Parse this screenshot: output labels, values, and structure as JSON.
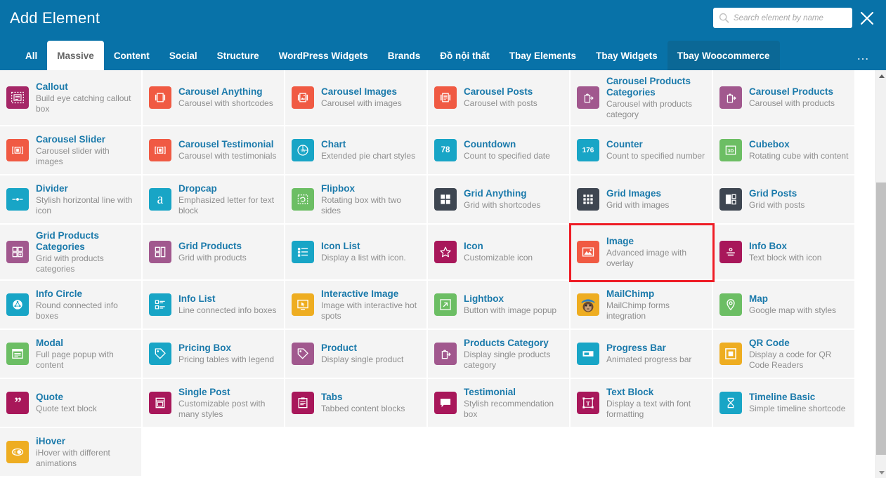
{
  "header": {
    "title": "Add Element",
    "search": {
      "placeholder": "Search element by name",
      "value": ""
    },
    "search_icon": "search-icon",
    "close_icon": "close-icon",
    "bg_color": "#0872a8"
  },
  "tabs": {
    "more_label": "…",
    "items": [
      {
        "label": "All",
        "state": "normal"
      },
      {
        "label": "Massive",
        "state": "active"
      },
      {
        "label": "Content",
        "state": "normal"
      },
      {
        "label": "Social",
        "state": "normal"
      },
      {
        "label": "Structure",
        "state": "normal"
      },
      {
        "label": "WordPress Widgets",
        "state": "normal"
      },
      {
        "label": "Brands",
        "state": "normal"
      },
      {
        "label": "Đồ nội thất",
        "state": "normal"
      },
      {
        "label": "Tbay Elements",
        "state": "normal"
      },
      {
        "label": "Tbay Widgets",
        "state": "normal"
      },
      {
        "label": "Tbay Woocommerce",
        "state": "semiactive"
      }
    ]
  },
  "colors": {
    "title_link": "#1b7aab",
    "desc": "#8e8e8e",
    "card_bg": "#f4f4f4",
    "selection_outline": "#ee1c25"
  },
  "elements": [
    {
      "title": "Callout",
      "desc": "Build eye catching callout box",
      "icon": "callout-icon",
      "color": "#a52767"
    },
    {
      "title": "Carousel Anything",
      "desc": "Carousel with shortcodes",
      "icon": "carousel-anything-icon",
      "color": "#f05a43"
    },
    {
      "title": "Carousel Images",
      "desc": "Carousel with images",
      "icon": "carousel-images-icon",
      "color": "#f05a43"
    },
    {
      "title": "Carousel Posts",
      "desc": "Carousel with posts",
      "icon": "carousel-posts-icon",
      "color": "#f05a43"
    },
    {
      "title": "Carousel Products Categories",
      "desc": "Carousel with products category",
      "icon": "carousel-products-categories-icon",
      "color": "#a1588e"
    },
    {
      "title": "Carousel Products",
      "desc": "Carousel with products",
      "icon": "carousel-products-icon",
      "color": "#a1588e"
    },
    {
      "title": "Carousel Slider",
      "desc": "Carousel slider with images",
      "icon": "carousel-slider-icon",
      "color": "#f05a43"
    },
    {
      "title": "Carousel Testimonial",
      "desc": "Carousel with testimonials",
      "icon": "carousel-testimonial-icon",
      "color": "#f05a43"
    },
    {
      "title": "Chart",
      "desc": "Extended pie chart styles",
      "icon": "chart-icon",
      "color": "#18a5c6"
    },
    {
      "title": "Countdown",
      "desc": "Count to specified date",
      "icon": "countdown-icon",
      "color": "#18a5c6",
      "badge": "78"
    },
    {
      "title": "Counter",
      "desc": "Count to specified number",
      "icon": "counter-icon",
      "color": "#18a5c6",
      "badge": "176"
    },
    {
      "title": "Cubebox",
      "desc": "Rotating cube with content",
      "icon": "cubebox-icon",
      "color": "#6cbe64"
    },
    {
      "title": "Divider",
      "desc": "Stylish horizontal line with icon",
      "icon": "divider-icon",
      "color": "#18a5c6"
    },
    {
      "title": "Dropcap",
      "desc": "Emphasized letter for text block",
      "icon": "dropcap-icon",
      "color": "#18a5c6",
      "glyph": "a"
    },
    {
      "title": "Flipbox",
      "desc": "Rotating box with two sides",
      "icon": "flipbox-icon",
      "color": "#6cbe64"
    },
    {
      "title": "Grid Anything",
      "desc": "Grid with shortcodes",
      "icon": "grid-anything-icon",
      "color": "#3e4651"
    },
    {
      "title": "Grid Images",
      "desc": "Grid with images",
      "icon": "grid-images-icon",
      "color": "#3e4651"
    },
    {
      "title": "Grid Posts",
      "desc": "Grid with posts",
      "icon": "grid-posts-icon",
      "color": "#3e4651"
    },
    {
      "title": "Grid Products Categories",
      "desc": "Grid with products categories",
      "icon": "grid-products-categories-icon",
      "color": "#a1588e"
    },
    {
      "title": "Grid Products",
      "desc": "Grid with products",
      "icon": "grid-products-icon",
      "color": "#a1588e"
    },
    {
      "title": "Icon List",
      "desc": "Display a list with icon.",
      "icon": "icon-list-icon",
      "color": "#18a5c6"
    },
    {
      "title": "Icon",
      "desc": "Customizable icon",
      "icon": "star-icon",
      "color": "#a8175a"
    },
    {
      "title": "Image",
      "desc": "Advanced image with overlay",
      "icon": "image-icon",
      "color": "#f05a43",
      "selected": true
    },
    {
      "title": "Info Box",
      "desc": "Text block with icon",
      "icon": "info-box-icon",
      "color": "#a8175a"
    },
    {
      "title": "Info Circle",
      "desc": "Round connected info boxes",
      "icon": "info-circle-icon",
      "color": "#18a5c6"
    },
    {
      "title": "Info List",
      "desc": "Line connected info boxes",
      "icon": "info-list-icon",
      "color": "#18a5c6"
    },
    {
      "title": "Interactive Image",
      "desc": "Image with interactive hot spots",
      "icon": "interactive-image-icon",
      "color": "#eead21"
    },
    {
      "title": "Lightbox",
      "desc": "Button with image popup",
      "icon": "lightbox-icon",
      "color": "#6cbe64"
    },
    {
      "title": "MailChimp",
      "desc": "MailChimp forms integration",
      "icon": "mailchimp-icon",
      "color": "#eead21"
    },
    {
      "title": "Map",
      "desc": "Google map with styles",
      "icon": "map-pin-icon",
      "color": "#6cbe64"
    },
    {
      "title": "Modal",
      "desc": "Full page popup with content",
      "icon": "modal-icon",
      "color": "#6cbe64"
    },
    {
      "title": "Pricing Box",
      "desc": "Pricing tables with legend",
      "icon": "pricing-box-icon",
      "color": "#18a5c6"
    },
    {
      "title": "Product",
      "desc": "Display single product",
      "icon": "product-tag-icon",
      "color": "#a1588e"
    },
    {
      "title": "Products Category",
      "desc": "Display single products category",
      "icon": "products-category-icon",
      "color": "#a1588e"
    },
    {
      "title": "Progress Bar",
      "desc": "Animated progress bar",
      "icon": "progress-bar-icon",
      "color": "#18a5c6"
    },
    {
      "title": "QR Code",
      "desc": "Display a code for QR Code Readers",
      "icon": "qr-code-icon",
      "color": "#eead21"
    },
    {
      "title": "Quote",
      "desc": "Quote text block",
      "icon": "quote-icon",
      "color": "#a8175a"
    },
    {
      "title": "Single Post",
      "desc": "Customizable post with many styles",
      "icon": "single-post-icon",
      "color": "#a8175a"
    },
    {
      "title": "Tabs",
      "desc": "Tabbed content blocks",
      "icon": "tabs-icon",
      "color": "#a8175a"
    },
    {
      "title": "Testimonial",
      "desc": "Stylish recommendation box",
      "icon": "testimonial-icon",
      "color": "#a8175a"
    },
    {
      "title": "Text Block",
      "desc": "Display a text with font formatting",
      "icon": "text-block-icon",
      "color": "#a8175a"
    },
    {
      "title": "Timeline Basic",
      "desc": "Simple timeline shortcode",
      "icon": "timeline-icon",
      "color": "#18a5c6"
    },
    {
      "title": "iHover",
      "desc": "iHover with different animations",
      "icon": "ihover-icon",
      "color": "#eead21"
    }
  ],
  "scrollbar": {
    "up_icon": "scroll-up-arrow",
    "down_icon": "scroll-down-arrow"
  }
}
